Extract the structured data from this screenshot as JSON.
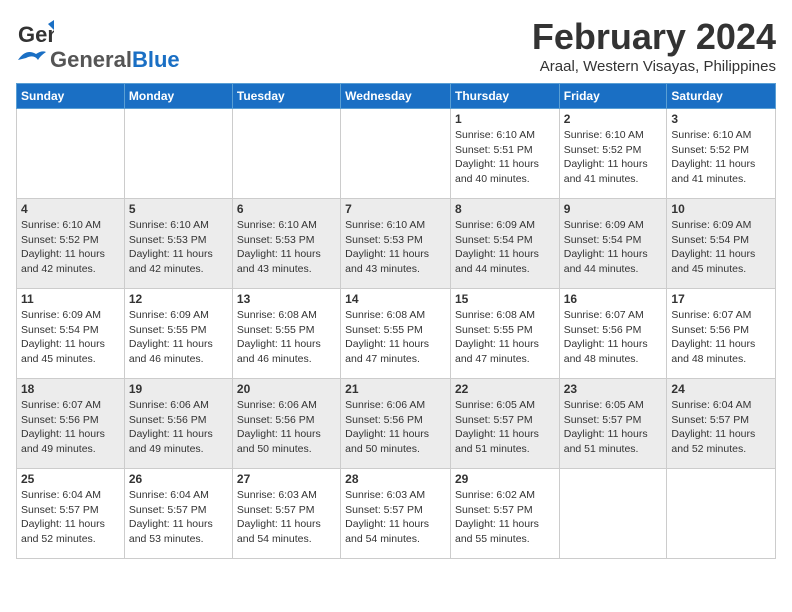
{
  "header": {
    "logo_general": "General",
    "logo_blue": "Blue",
    "month": "February 2024",
    "location": "Araal, Western Visayas, Philippines"
  },
  "days_of_week": [
    "Sunday",
    "Monday",
    "Tuesday",
    "Wednesday",
    "Thursday",
    "Friday",
    "Saturday"
  ],
  "weeks": [
    [
      {
        "day": "",
        "info": ""
      },
      {
        "day": "",
        "info": ""
      },
      {
        "day": "",
        "info": ""
      },
      {
        "day": "",
        "info": ""
      },
      {
        "day": "1",
        "info": "Sunrise: 6:10 AM\nSunset: 5:51 PM\nDaylight: 11 hours and 40 minutes."
      },
      {
        "day": "2",
        "info": "Sunrise: 6:10 AM\nSunset: 5:52 PM\nDaylight: 11 hours and 41 minutes."
      },
      {
        "day": "3",
        "info": "Sunrise: 6:10 AM\nSunset: 5:52 PM\nDaylight: 11 hours and 41 minutes."
      }
    ],
    [
      {
        "day": "4",
        "info": "Sunrise: 6:10 AM\nSunset: 5:52 PM\nDaylight: 11 hours and 42 minutes."
      },
      {
        "day": "5",
        "info": "Sunrise: 6:10 AM\nSunset: 5:53 PM\nDaylight: 11 hours and 42 minutes."
      },
      {
        "day": "6",
        "info": "Sunrise: 6:10 AM\nSunset: 5:53 PM\nDaylight: 11 hours and 43 minutes."
      },
      {
        "day": "7",
        "info": "Sunrise: 6:10 AM\nSunset: 5:53 PM\nDaylight: 11 hours and 43 minutes."
      },
      {
        "day": "8",
        "info": "Sunrise: 6:09 AM\nSunset: 5:54 PM\nDaylight: 11 hours and 44 minutes."
      },
      {
        "day": "9",
        "info": "Sunrise: 6:09 AM\nSunset: 5:54 PM\nDaylight: 11 hours and 44 minutes."
      },
      {
        "day": "10",
        "info": "Sunrise: 6:09 AM\nSunset: 5:54 PM\nDaylight: 11 hours and 45 minutes."
      }
    ],
    [
      {
        "day": "11",
        "info": "Sunrise: 6:09 AM\nSunset: 5:54 PM\nDaylight: 11 hours and 45 minutes."
      },
      {
        "day": "12",
        "info": "Sunrise: 6:09 AM\nSunset: 5:55 PM\nDaylight: 11 hours and 46 minutes."
      },
      {
        "day": "13",
        "info": "Sunrise: 6:08 AM\nSunset: 5:55 PM\nDaylight: 11 hours and 46 minutes."
      },
      {
        "day": "14",
        "info": "Sunrise: 6:08 AM\nSunset: 5:55 PM\nDaylight: 11 hours and 47 minutes."
      },
      {
        "day": "15",
        "info": "Sunrise: 6:08 AM\nSunset: 5:55 PM\nDaylight: 11 hours and 47 minutes."
      },
      {
        "day": "16",
        "info": "Sunrise: 6:07 AM\nSunset: 5:56 PM\nDaylight: 11 hours and 48 minutes."
      },
      {
        "day": "17",
        "info": "Sunrise: 6:07 AM\nSunset: 5:56 PM\nDaylight: 11 hours and 48 minutes."
      }
    ],
    [
      {
        "day": "18",
        "info": "Sunrise: 6:07 AM\nSunset: 5:56 PM\nDaylight: 11 hours and 49 minutes."
      },
      {
        "day": "19",
        "info": "Sunrise: 6:06 AM\nSunset: 5:56 PM\nDaylight: 11 hours and 49 minutes."
      },
      {
        "day": "20",
        "info": "Sunrise: 6:06 AM\nSunset: 5:56 PM\nDaylight: 11 hours and 50 minutes."
      },
      {
        "day": "21",
        "info": "Sunrise: 6:06 AM\nSunset: 5:56 PM\nDaylight: 11 hours and 50 minutes."
      },
      {
        "day": "22",
        "info": "Sunrise: 6:05 AM\nSunset: 5:57 PM\nDaylight: 11 hours and 51 minutes."
      },
      {
        "day": "23",
        "info": "Sunrise: 6:05 AM\nSunset: 5:57 PM\nDaylight: 11 hours and 51 minutes."
      },
      {
        "day": "24",
        "info": "Sunrise: 6:04 AM\nSunset: 5:57 PM\nDaylight: 11 hours and 52 minutes."
      }
    ],
    [
      {
        "day": "25",
        "info": "Sunrise: 6:04 AM\nSunset: 5:57 PM\nDaylight: 11 hours and 52 minutes."
      },
      {
        "day": "26",
        "info": "Sunrise: 6:04 AM\nSunset: 5:57 PM\nDaylight: 11 hours and 53 minutes."
      },
      {
        "day": "27",
        "info": "Sunrise: 6:03 AM\nSunset: 5:57 PM\nDaylight: 11 hours and 54 minutes."
      },
      {
        "day": "28",
        "info": "Sunrise: 6:03 AM\nSunset: 5:57 PM\nDaylight: 11 hours and 54 minutes."
      },
      {
        "day": "29",
        "info": "Sunrise: 6:02 AM\nSunset: 5:57 PM\nDaylight: 11 hours and 55 minutes."
      },
      {
        "day": "",
        "info": ""
      },
      {
        "day": "",
        "info": ""
      }
    ]
  ]
}
